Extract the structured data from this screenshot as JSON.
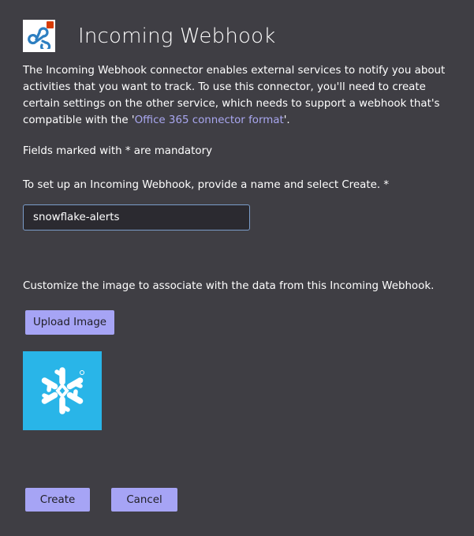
{
  "header": {
    "title": "Incoming Webhook",
    "icon": "webhook-icon"
  },
  "description": {
    "text_before_link": "The Incoming Webhook connector enables external services to notify you about activities that you want to track. To use this connector, you'll need to create certain settings on the other service, which needs to support a webhook that's compatible with the '",
    "link_text": "Office 365 connector format",
    "text_after_link": "'."
  },
  "mandatory_note": "Fields marked with * are mandatory",
  "setup_label": "To set up an Incoming Webhook, provide a name and select Create. *",
  "name_input": {
    "value": "snowflake-alerts"
  },
  "customize_label": "Customize the image to associate with the data from this Incoming Webhook.",
  "upload_button": "Upload Image",
  "image": {
    "icon": "snowflake-logo",
    "color": "#29b5e8"
  },
  "actions": {
    "create": "Create",
    "cancel": "Cancel"
  },
  "colors": {
    "background": "#3f3e44",
    "accent_button": "#a6a4f5",
    "link": "#a9a7f0",
    "input_border": "#7a9cc9"
  }
}
